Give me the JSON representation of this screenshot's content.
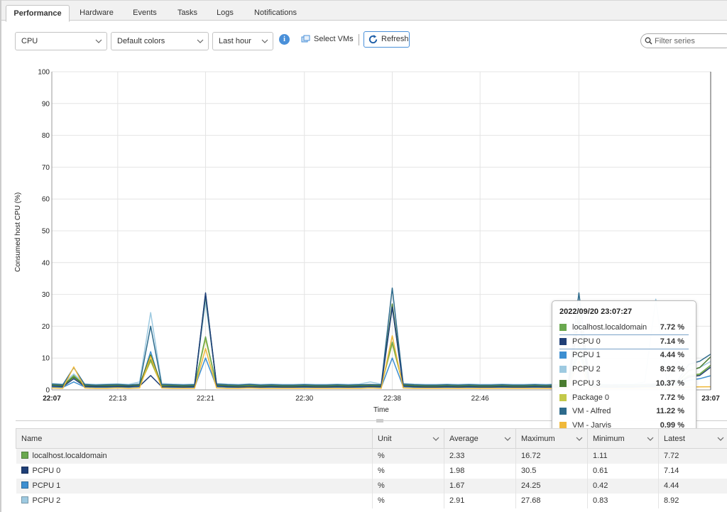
{
  "tabs": [
    "Performance",
    "Hardware",
    "Events",
    "Tasks",
    "Logs",
    "Notifications"
  ],
  "toolbar": {
    "metric": "CPU",
    "colors": "Default colors",
    "range": "Last hour",
    "info": "i",
    "select_vms": "Select VMs",
    "refresh": "Refresh",
    "filter_placeholder": "Filter series"
  },
  "colors": {
    "localhost": "#6aa84f",
    "pcpu0": "#1f3f77",
    "pcpu1": "#3d8fd1",
    "pcpu2": "#9ecae1",
    "pcpu3": "#4a7c2f",
    "package0": "#c3c94a",
    "alfred": "#2e6b8c",
    "jarvis": "#f0b93a"
  },
  "chart_data": {
    "type": "line",
    "ylabel": "Consumed host CPU (%)",
    "xlabel": "Time",
    "ylim": [
      0,
      100
    ],
    "yticks": [
      0,
      10,
      20,
      30,
      40,
      50,
      60,
      70,
      80,
      90,
      100
    ],
    "xticks": [
      "22:07",
      "22:13",
      "22:21",
      "22:30",
      "22:38",
      "22:46",
      "22:55",
      "23:07"
    ],
    "grid": true,
    "x": [
      "22:07",
      "22:08",
      "22:09",
      "22:10",
      "22:11",
      "22:12",
      "22:13",
      "22:14",
      "22:15",
      "22:16",
      "22:17",
      "22:18",
      "22:19",
      "22:20",
      "22:21",
      "22:22",
      "22:23",
      "22:24",
      "22:25",
      "22:26",
      "22:27",
      "22:28",
      "22:29",
      "22:30",
      "22:31",
      "22:32",
      "22:33",
      "22:34",
      "22:35",
      "22:36",
      "22:37",
      "22:38",
      "22:39",
      "22:40",
      "22:41",
      "22:42",
      "22:43",
      "22:44",
      "22:45",
      "22:46",
      "22:47",
      "22:48",
      "22:49",
      "22:50",
      "22:51",
      "22:52",
      "22:53",
      "22:54",
      "22:55",
      "22:56",
      "22:57",
      "22:58",
      "22:59",
      "23:00",
      "23:01",
      "23:02",
      "23:03",
      "23:04",
      "23:05",
      "23:06",
      "23:07"
    ],
    "series": [
      {
        "name": "localhost.localdomain",
        "color": "#6aa84f",
        "values": [
          1.5,
          1.3,
          4.5,
          1.4,
          1.2,
          1.3,
          1.4,
          1.2,
          1.5,
          9.5,
          1.4,
          1.3,
          1.2,
          1.3,
          16.7,
          1.5,
          1.3,
          1.2,
          1.4,
          1.2,
          1.3,
          1.2,
          1.2,
          1.3,
          1.2,
          1.2,
          1.3,
          1.2,
          1.3,
          1.4,
          1.3,
          15.0,
          1.5,
          1.3,
          1.2,
          1.2,
          1.3,
          1.2,
          1.3,
          1.2,
          1.2,
          1.3,
          1.2,
          1.2,
          1.3,
          1.2,
          1.3,
          1.2,
          14.0,
          1.4,
          1.3,
          1.2,
          1.3,
          1.3,
          1.4,
          1.5,
          2.0,
          2.2,
          4.5,
          5.0,
          7.72
        ]
      },
      {
        "name": "PCPU 0",
        "color": "#1f3f77",
        "values": [
          1.2,
          1.0,
          3.5,
          1.1,
          1.0,
          1.0,
          1.1,
          1.0,
          1.2,
          4.5,
          1.0,
          1.0,
          0.9,
          1.0,
          30.5,
          1.2,
          1.0,
          0.9,
          1.0,
          0.9,
          1.0,
          0.9,
          0.9,
          1.0,
          0.9,
          0.9,
          1.0,
          0.9,
          1.0,
          1.1,
          1.0,
          26.0,
          1.2,
          1.0,
          0.9,
          0.9,
          1.0,
          0.9,
          1.0,
          0.9,
          0.9,
          1.0,
          0.9,
          0.9,
          1.0,
          0.9,
          1.0,
          0.9,
          22.0,
          1.1,
          1.0,
          0.9,
          1.0,
          1.0,
          1.1,
          1.2,
          1.8,
          2.0,
          4.0,
          4.5,
          7.14
        ]
      },
      {
        "name": "PCPU 1",
        "color": "#3d8fd1",
        "values": [
          0.9,
          0.8,
          2.5,
          0.9,
          0.8,
          0.8,
          0.9,
          0.8,
          1.0,
          12.0,
          0.8,
          0.8,
          0.7,
          0.8,
          10.0,
          1.0,
          0.8,
          0.7,
          0.8,
          0.7,
          0.8,
          0.7,
          0.7,
          0.8,
          0.7,
          0.7,
          0.8,
          0.7,
          0.8,
          0.9,
          0.8,
          10.0,
          1.0,
          0.8,
          0.7,
          0.7,
          0.8,
          0.7,
          0.8,
          0.7,
          0.7,
          0.8,
          0.7,
          0.7,
          0.8,
          0.7,
          0.8,
          0.7,
          12.0,
          0.9,
          0.8,
          0.7,
          0.8,
          0.8,
          0.9,
          1.0,
          1.5,
          1.7,
          3.0,
          3.5,
          4.44
        ]
      },
      {
        "name": "PCPU 2",
        "color": "#9ecae1",
        "values": [
          2.0,
          1.8,
          5.0,
          1.9,
          1.7,
          1.8,
          1.9,
          1.7,
          2.5,
          24.3,
          2.0,
          1.8,
          1.7,
          1.8,
          27.7,
          2.0,
          1.8,
          1.7,
          1.9,
          1.7,
          1.8,
          1.7,
          1.7,
          1.8,
          1.7,
          1.7,
          1.8,
          1.7,
          1.8,
          2.5,
          1.8,
          26.0,
          2.0,
          1.8,
          1.7,
          1.7,
          1.8,
          1.7,
          1.8,
          1.7,
          1.7,
          1.8,
          1.7,
          1.7,
          1.8,
          1.7,
          1.8,
          1.7,
          16.0,
          1.9,
          1.8,
          1.7,
          1.8,
          1.8,
          2.5,
          28.5,
          3.0,
          9.0,
          6.0,
          7.0,
          8.92
        ]
      },
      {
        "name": "PCPU 3",
        "color": "#4a7c2f",
        "values": [
          1.6,
          1.4,
          4.0,
          1.5,
          1.3,
          1.4,
          1.5,
          1.3,
          1.6,
          11.0,
          1.5,
          1.4,
          1.3,
          1.4,
          29.5,
          1.6,
          1.4,
          1.3,
          1.5,
          1.3,
          1.4,
          1.3,
          1.3,
          1.4,
          1.3,
          1.3,
          1.4,
          1.3,
          1.4,
          1.5,
          1.4,
          27.0,
          1.6,
          1.4,
          1.3,
          1.3,
          1.4,
          1.3,
          1.4,
          1.3,
          1.3,
          1.4,
          1.3,
          1.3,
          1.4,
          1.3,
          1.4,
          1.3,
          25.0,
          1.5,
          1.4,
          1.3,
          1.4,
          1.4,
          1.5,
          1.6,
          2.2,
          2.5,
          6.0,
          7.0,
          10.37
        ]
      },
      {
        "name": "Package 0",
        "color": "#c3c94a",
        "values": [
          1.4,
          1.2,
          4.2,
          1.3,
          1.1,
          1.2,
          1.3,
          1.1,
          1.4,
          9.0,
          1.3,
          1.2,
          1.1,
          1.2,
          16.0,
          1.4,
          1.2,
          1.1,
          1.3,
          1.1,
          1.2,
          1.1,
          1.1,
          1.2,
          1.1,
          1.1,
          1.2,
          1.1,
          1.2,
          1.3,
          1.2,
          14.5,
          1.4,
          1.2,
          1.1,
          1.1,
          1.2,
          1.1,
          1.2,
          1.1,
          1.1,
          1.2,
          1.1,
          1.1,
          1.2,
          1.1,
          1.2,
          1.1,
          13.5,
          1.3,
          1.2,
          1.1,
          1.2,
          1.2,
          1.3,
          1.4,
          1.9,
          2.1,
          4.3,
          4.8,
          7.72
        ]
      },
      {
        "name": "VM - Alfred",
        "color": "#2e6b8c",
        "values": [
          1.8,
          1.6,
          7.0,
          1.7,
          1.5,
          1.6,
          1.7,
          1.5,
          1.8,
          20.0,
          1.7,
          1.6,
          1.5,
          1.6,
          30.0,
          1.8,
          1.6,
          1.5,
          1.7,
          1.5,
          1.6,
          1.5,
          1.5,
          1.6,
          1.5,
          1.5,
          1.6,
          1.5,
          1.6,
          1.7,
          1.6,
          32.0,
          1.8,
          1.6,
          1.5,
          1.5,
          1.6,
          1.5,
          1.6,
          1.5,
          1.5,
          1.6,
          1.5,
          1.5,
          1.6,
          1.5,
          1.6,
          1.5,
          30.5,
          1.7,
          1.6,
          1.5,
          1.6,
          1.6,
          1.7,
          1.8,
          2.5,
          3.0,
          8.0,
          9.0,
          11.22
        ]
      },
      {
        "name": "VM - Jarvis",
        "color": "#f0b93a",
        "values": [
          0.6,
          0.5,
          7.2,
          0.6,
          0.5,
          0.5,
          0.6,
          0.5,
          0.6,
          10.5,
          0.6,
          0.5,
          0.5,
          0.5,
          13.0,
          0.6,
          0.5,
          0.5,
          0.6,
          0.5,
          0.5,
          0.5,
          0.5,
          0.5,
          0.5,
          0.5,
          0.5,
          0.5,
          0.5,
          0.6,
          0.5,
          17.0,
          0.6,
          0.5,
          0.5,
          0.5,
          0.5,
          0.5,
          0.5,
          0.5,
          0.5,
          0.5,
          0.5,
          0.5,
          0.5,
          0.5,
          0.5,
          0.5,
          9.0,
          0.6,
          0.5,
          0.5,
          0.5,
          0.5,
          0.6,
          0.6,
          0.8,
          0.9,
          0.9,
          0.95,
          0.99
        ]
      }
    ]
  },
  "tooltip": {
    "title": "2022/09/20 23:07:27",
    "rows": [
      {
        "name": "localhost.localdomain",
        "value": "7.72 %",
        "color": "#6aa84f"
      },
      {
        "name": "PCPU 0",
        "value": "7.14 %",
        "color": "#1f3f77"
      },
      {
        "name": "PCPU 1",
        "value": "4.44 %",
        "color": "#3d8fd1"
      },
      {
        "name": "PCPU 2",
        "value": "8.92 %",
        "color": "#9ecae1"
      },
      {
        "name": "PCPU 3",
        "value": "10.37 %",
        "color": "#4a7c2f"
      },
      {
        "name": "Package 0",
        "value": "7.72 %",
        "color": "#c3c94a"
      },
      {
        "name": "VM - Alfred",
        "value": "11.22 %",
        "color": "#2e6b8c"
      },
      {
        "name": "VM - Jarvis",
        "value": "0.99 %",
        "color": "#f0b93a"
      }
    ]
  },
  "table": {
    "columns": [
      "Name",
      "Unit",
      "Average",
      "Maximum",
      "Minimum",
      "Latest"
    ],
    "rows": [
      {
        "name": "localhost.localdomain",
        "color": "#6aa84f",
        "unit": "%",
        "average": "2.33",
        "maximum": "16.72",
        "minimum": "1.11",
        "latest": "7.72"
      },
      {
        "name": "PCPU 0",
        "color": "#1f3f77",
        "unit": "%",
        "average": "1.98",
        "maximum": "30.5",
        "minimum": "0.61",
        "latest": "7.14"
      },
      {
        "name": "PCPU 1",
        "color": "#3d8fd1",
        "unit": "%",
        "average": "1.67",
        "maximum": "24.25",
        "minimum": "0.42",
        "latest": "4.44"
      },
      {
        "name": "PCPU 2",
        "color": "#9ecae1",
        "unit": "%",
        "average": "2.91",
        "maximum": "27.68",
        "minimum": "0.83",
        "latest": "8.92"
      }
    ]
  }
}
